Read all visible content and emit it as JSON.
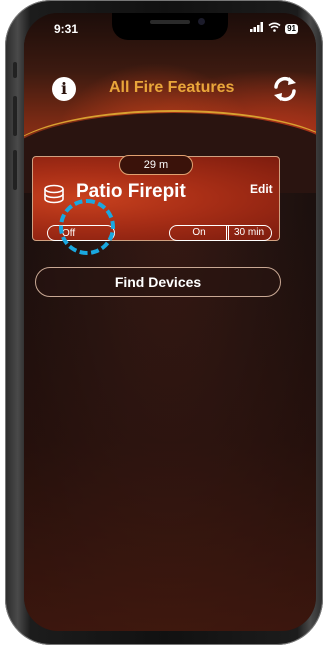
{
  "status_bar": {
    "time": "9:31",
    "signal_icon": "signal-icon",
    "wifi_icon": "wifi-icon",
    "battery_level": "91"
  },
  "header": {
    "title": "All Fire Features",
    "info_icon": "info-icon",
    "info_glyph": "i",
    "refresh_icon": "refresh-icon"
  },
  "device_card": {
    "timer": "29 m",
    "name": "Patio Firepit",
    "icon": "firepit-icon",
    "edit_label": "Edit",
    "off_label": "Off",
    "on_label": "On",
    "duration_label": "30 min"
  },
  "actions": {
    "find_devices_label": "Find Devices"
  },
  "colors": {
    "title_color": "#e9a63a",
    "card_accent": "#a82e16",
    "highlight": "#1aa8e0"
  }
}
